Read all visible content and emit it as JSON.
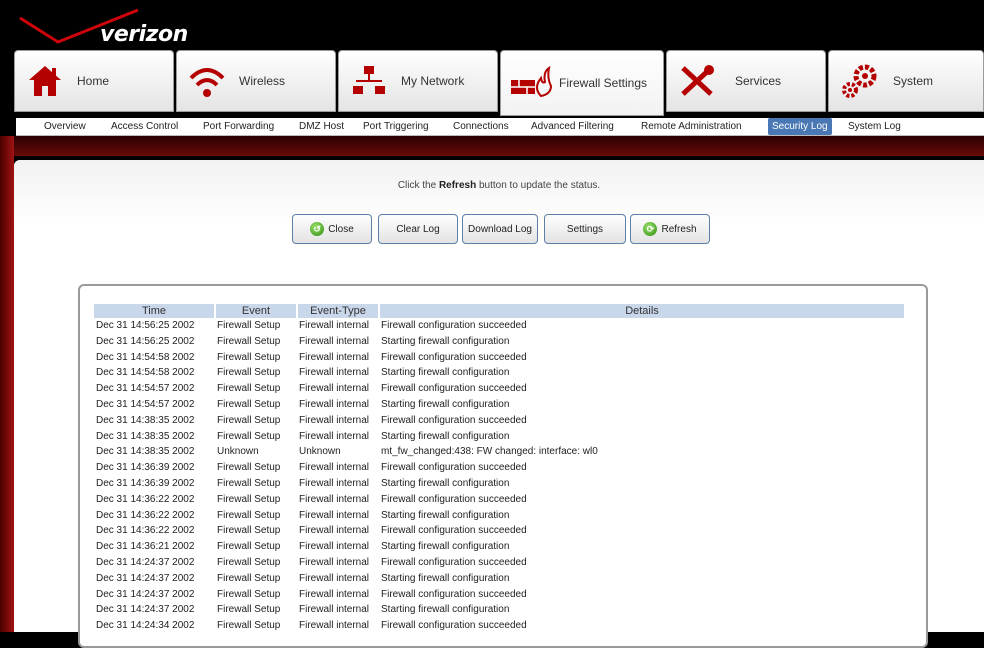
{
  "brand": {
    "name": "verizon"
  },
  "colors": {
    "accent": "#4a78b4",
    "brand_red": "#cd040b",
    "header_bg": "#000000"
  },
  "tabs": [
    {
      "label": "Home",
      "icon": "home-icon",
      "active": false
    },
    {
      "label": "Wireless",
      "icon": "wifi-icon",
      "active": false
    },
    {
      "label": "My Network",
      "icon": "network-icon",
      "active": false
    },
    {
      "label": "Firewall Settings",
      "icon": "firewall-icon",
      "active": true
    },
    {
      "label": "Services",
      "icon": "tools-icon",
      "active": false
    },
    {
      "label": "System",
      "icon": "gears-icon",
      "active": false
    }
  ],
  "subnav": [
    {
      "label": "Overview"
    },
    {
      "label": "Access Control"
    },
    {
      "label": "Port Forwarding"
    },
    {
      "label": "DMZ Host"
    },
    {
      "label": "Port Triggering"
    },
    {
      "label": "Connections"
    },
    {
      "label": "Advanced Filtering"
    },
    {
      "label": "Remote Administration"
    },
    {
      "label": "Security Log",
      "selected": true
    },
    {
      "label": "System Log"
    }
  ],
  "hint": {
    "before": "Click the ",
    "bold": "Refresh",
    "after": " button to update the status."
  },
  "buttons": {
    "close": "Close",
    "clear_log": "Clear Log",
    "download_log": "Download Log",
    "settings": "Settings",
    "refresh": "Refresh"
  },
  "log": {
    "columns": [
      "Time",
      "Event",
      "Event-Type",
      "Details"
    ],
    "rows": [
      [
        "Dec 31 14:56:25 2002",
        "Firewall Setup",
        "Firewall internal",
        "Firewall configuration succeeded"
      ],
      [
        "Dec 31 14:56:25 2002",
        "Firewall Setup",
        "Firewall internal",
        "Starting firewall configuration"
      ],
      [
        "Dec 31 14:54:58 2002",
        "Firewall Setup",
        "Firewall internal",
        "Firewall configuration succeeded"
      ],
      [
        "Dec 31 14:54:58 2002",
        "Firewall Setup",
        "Firewall internal",
        "Starting firewall configuration"
      ],
      [
        "Dec 31 14:54:57 2002",
        "Firewall Setup",
        "Firewall internal",
        "Firewall configuration succeeded"
      ],
      [
        "Dec 31 14:54:57 2002",
        "Firewall Setup",
        "Firewall internal",
        "Starting firewall configuration"
      ],
      [
        "Dec 31 14:38:35 2002",
        "Firewall Setup",
        "Firewall internal",
        "Firewall configuration succeeded"
      ],
      [
        "Dec 31 14:38:35 2002",
        "Firewall Setup",
        "Firewall internal",
        "Starting firewall configuration"
      ],
      [
        "Dec 31 14:38:35 2002",
        "Unknown",
        "Unknown",
        "mt_fw_changed:438: FW changed: interface: wl0"
      ],
      [
        "Dec 31 14:36:39 2002",
        "Firewall Setup",
        "Firewall internal",
        "Firewall configuration succeeded"
      ],
      [
        "Dec 31 14:36:39 2002",
        "Firewall Setup",
        "Firewall internal",
        "Starting firewall configuration"
      ],
      [
        "Dec 31 14:36:22 2002",
        "Firewall Setup",
        "Firewall internal",
        "Firewall configuration succeeded"
      ],
      [
        "Dec 31 14:36:22 2002",
        "Firewall Setup",
        "Firewall internal",
        "Starting firewall configuration"
      ],
      [
        "Dec 31 14:36:22 2002",
        "Firewall Setup",
        "Firewall internal",
        "Firewall configuration succeeded"
      ],
      [
        "Dec 31 14:36:21 2002",
        "Firewall Setup",
        "Firewall internal",
        "Starting firewall configuration"
      ],
      [
        "Dec 31 14:24:37 2002",
        "Firewall Setup",
        "Firewall internal",
        "Firewall configuration succeeded"
      ],
      [
        "Dec 31 14:24:37 2002",
        "Firewall Setup",
        "Firewall internal",
        "Starting firewall configuration"
      ],
      [
        "Dec 31 14:24:37 2002",
        "Firewall Setup",
        "Firewall internal",
        "Firewall configuration succeeded"
      ],
      [
        "Dec 31 14:24:37 2002",
        "Firewall Setup",
        "Firewall internal",
        "Starting firewall configuration"
      ],
      [
        "Dec 31 14:24:34 2002",
        "Firewall Setup",
        "Firewall internal",
        "Firewall configuration succeeded"
      ]
    ]
  }
}
